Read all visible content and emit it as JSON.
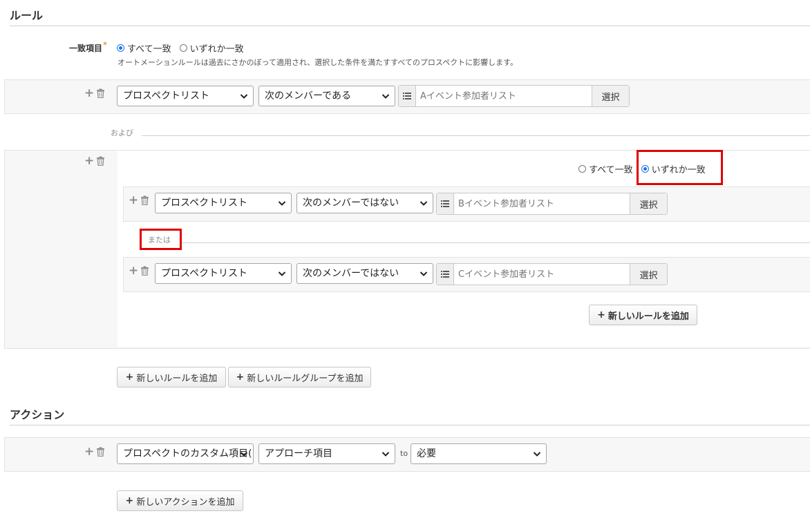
{
  "sections": {
    "rules_title": "ルール",
    "actions_title": "アクション"
  },
  "match": {
    "label": "一致項目",
    "required_mark": "*",
    "option_all": "すべて一致",
    "option_any": "いずれか一致",
    "selected": "all",
    "description": "オートメーションルールは過去にさかのぼって適用され、選択した条件を満たすすべてのプロスペクトに影響します。"
  },
  "rule1": {
    "field": "プロスペクトリスト",
    "operator": "次のメンバーである",
    "value_placeholder": "Aイベント参加者リスト",
    "select_label": "選択"
  },
  "connector_and": "および",
  "group": {
    "option_all": "すべて一致",
    "option_any": "いずれか一致",
    "selected": "any",
    "connector_or": "または",
    "rules": [
      {
        "field": "プロスペクトリスト",
        "operator": "次のメンバーではない",
        "value_placeholder": "Bイベント参加者リスト",
        "select_label": "選択"
      },
      {
        "field": "プロスペクトリスト",
        "operator": "次のメンバーではない",
        "value_placeholder": "Cイベント参加者リスト",
        "select_label": "選択"
      }
    ],
    "add_rule_label": "新しいルールを追加"
  },
  "buttons": {
    "add_rule": "新しいルールを追加",
    "add_rule_group": "新しいルールグループを追加",
    "add_action": "新しいアクションを追加"
  },
  "action": {
    "field": "プロスペクトのカスタム項目(",
    "item": "アプローチ項目",
    "to_label": "to",
    "value": "必要"
  },
  "colors": {
    "accent": "#1a73e8",
    "highlight": "#e00000",
    "panel_bg": "#f7f7f7"
  },
  "icons": {
    "add": "plus-icon",
    "delete": "trash-icon",
    "list": "list-icon",
    "dropdown": "chevron-down-icon"
  }
}
